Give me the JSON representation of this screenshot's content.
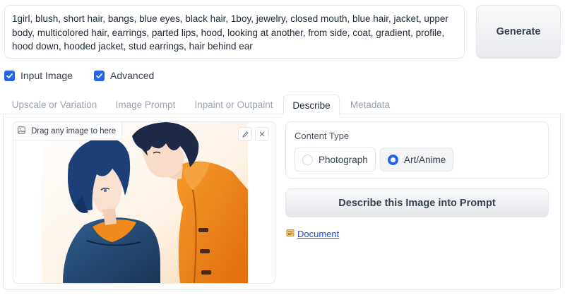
{
  "prompt": {
    "text": "1girl, blush, short hair, bangs, blue eyes, black hair, 1boy, jewelry, closed mouth, blue hair, jacket, upper body, multicolored hair, earrings, parted lips, hood, looking at another, from side, coat, gradient, profile, hood down, hooded jacket, stud earrings, hair behind ear"
  },
  "generate_button": {
    "label": "Generate"
  },
  "options": {
    "input_image": {
      "label": "Input Image",
      "checked": true
    },
    "advanced": {
      "label": "Advanced",
      "checked": true
    }
  },
  "tabs": [
    {
      "label": "Upscale or Variation",
      "active": false
    },
    {
      "label": "Image Prompt",
      "active": false
    },
    {
      "label": "Inpaint or Outpaint",
      "active": false
    },
    {
      "label": "Describe",
      "active": true
    },
    {
      "label": "Metadata",
      "active": false
    }
  ],
  "image_input": {
    "drag_label": "Drag any image to here",
    "icons": [
      "image-icon",
      "pencil-icon",
      "close-icon"
    ]
  },
  "content_type": {
    "label": "Content Type",
    "options": [
      {
        "label": "Photograph",
        "selected": false
      },
      {
        "label": "Art/Anime",
        "selected": true
      }
    ]
  },
  "describe_button": {
    "label": "Describe this Image into Prompt"
  },
  "document_link": {
    "label": "Document",
    "icon": "scroll-icon"
  },
  "colors": {
    "accent": "#2563eb",
    "link": "#1d4ed8",
    "border": "#e5e7eb"
  }
}
